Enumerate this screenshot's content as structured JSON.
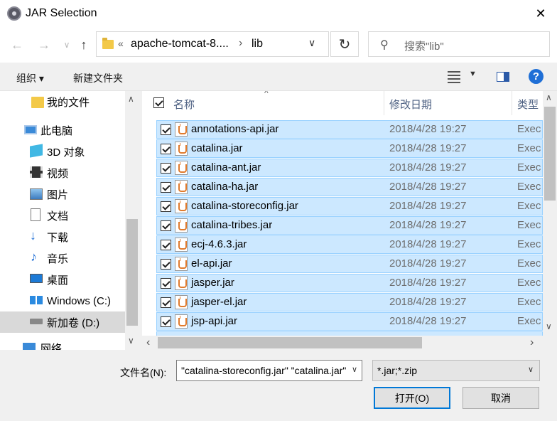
{
  "window": {
    "title": "JAR Selection",
    "close_glyph": "✕"
  },
  "nav": {
    "back_glyph": "←",
    "forward_glyph": "→",
    "recent_glyph": "∨",
    "up_glyph": "↑",
    "address": {
      "chevron": "«",
      "segment1": "apache-tomcat-8....",
      "separator": "›",
      "segment2": "lib",
      "dropdown": "∨"
    },
    "refresh_glyph": "↻",
    "search": {
      "placeholder": "搜索\"lib\"",
      "icon": "search-icon"
    }
  },
  "toolbar": {
    "organize": "组织 ▾",
    "new_folder": "新建文件夹",
    "view_dropdown": "▼",
    "help": "?"
  },
  "sidebar": {
    "items": [
      {
        "label": "我的文件",
        "icon": "folder-icon"
      },
      {
        "label": "此电脑",
        "icon": "computer-icon"
      },
      {
        "label": "3D 对象",
        "icon": "3d-objects-icon"
      },
      {
        "label": "视频",
        "icon": "video-icon"
      },
      {
        "label": "图片",
        "icon": "pictures-icon"
      },
      {
        "label": "文档",
        "icon": "documents-icon"
      },
      {
        "label": "下载",
        "icon": "download-icon"
      },
      {
        "label": "音乐",
        "icon": "music-icon"
      },
      {
        "label": "桌面",
        "icon": "desktop-icon"
      },
      {
        "label": "Windows  (C:)",
        "icon": "windows-drive-icon"
      },
      {
        "label": "新加卷 (D:)",
        "icon": "drive-icon"
      },
      {
        "label": "网络",
        "icon": "network-icon"
      }
    ],
    "scroll_up": "∧",
    "scroll_down": "∨"
  },
  "file_list": {
    "columns": {
      "name": "名称",
      "modified": "修改日期",
      "type": "类型"
    },
    "sort_glyph": "^",
    "rows": [
      {
        "name": "annotations-api.jar",
        "modified": "2018/4/28 19:27",
        "type": "Exec"
      },
      {
        "name": "catalina.jar",
        "modified": "2018/4/28 19:27",
        "type": "Exec"
      },
      {
        "name": "catalina-ant.jar",
        "modified": "2018/4/28 19:27",
        "type": "Exec"
      },
      {
        "name": "catalina-ha.jar",
        "modified": "2018/4/28 19:27",
        "type": "Exec"
      },
      {
        "name": "catalina-storeconfig.jar",
        "modified": "2018/4/28 19:27",
        "type": "Exec"
      },
      {
        "name": "catalina-tribes.jar",
        "modified": "2018/4/28 19:27",
        "type": "Exec"
      },
      {
        "name": "ecj-4.6.3.jar",
        "modified": "2018/4/28 19:27",
        "type": "Exec"
      },
      {
        "name": "el-api.jar",
        "modified": "2018/4/28 19:27",
        "type": "Exec"
      },
      {
        "name": "jasper.jar",
        "modified": "2018/4/28 19:27",
        "type": "Exec"
      },
      {
        "name": "jasper-el.jar",
        "modified": "2018/4/28 19:27",
        "type": "Exec"
      },
      {
        "name": "jsp-api.jar",
        "modified": "2018/4/28 19:27",
        "type": "Exec"
      }
    ],
    "scroll": {
      "up": "∧",
      "down": "∨",
      "left": "‹",
      "right": "›"
    }
  },
  "footer": {
    "filename_label": "文件名(N):",
    "filename_value": "\"catalina-storeconfig.jar\" \"catalina.jar\"",
    "filter_value": "*.jar;*.zip",
    "dropdown_glyph": "∨",
    "open_button": "打开(O)",
    "cancel_button": "取消"
  },
  "colors": {
    "selection": "#cce8ff",
    "selection_border": "#99d1ff",
    "accent": "#0078d7"
  }
}
